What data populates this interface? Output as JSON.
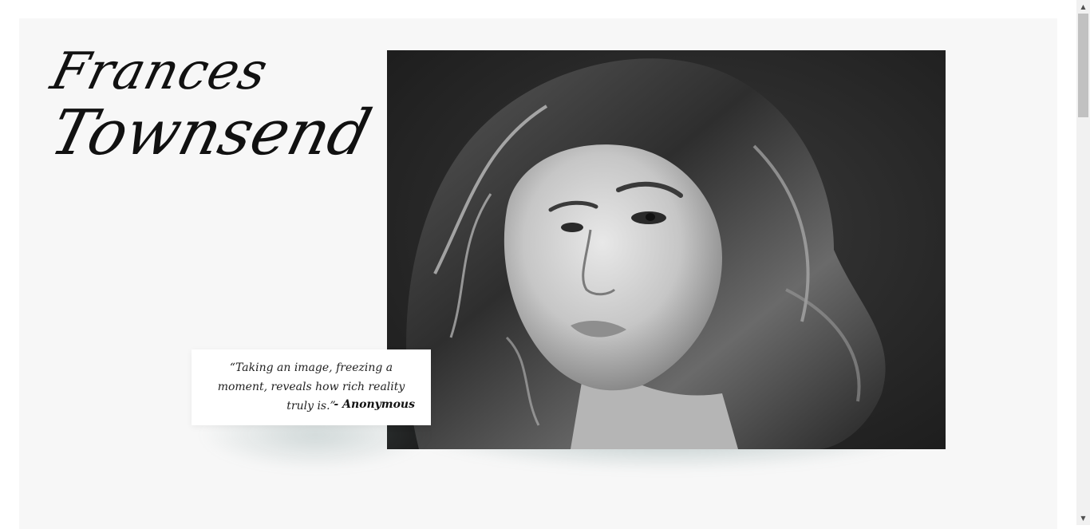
{
  "hero": {
    "name_first": "Frances",
    "name_last": "Townsend"
  },
  "photo": {
    "icon": "portrait-photo",
    "description_colors": {
      "background": "#262626",
      "skin": "#d8d8d8",
      "hair": "#3a3a3a"
    }
  },
  "quote": {
    "text": "“Taking an image, freezing a moment, reveals how rich reality truly is.”",
    "author": "- Anonymous"
  },
  "scrollbar": {
    "up_icon": "▲",
    "down_icon": "▼"
  },
  "colors": {
    "panel": "#f7f7f7",
    "text": "#111111",
    "shadow_tint": "#608282"
  }
}
